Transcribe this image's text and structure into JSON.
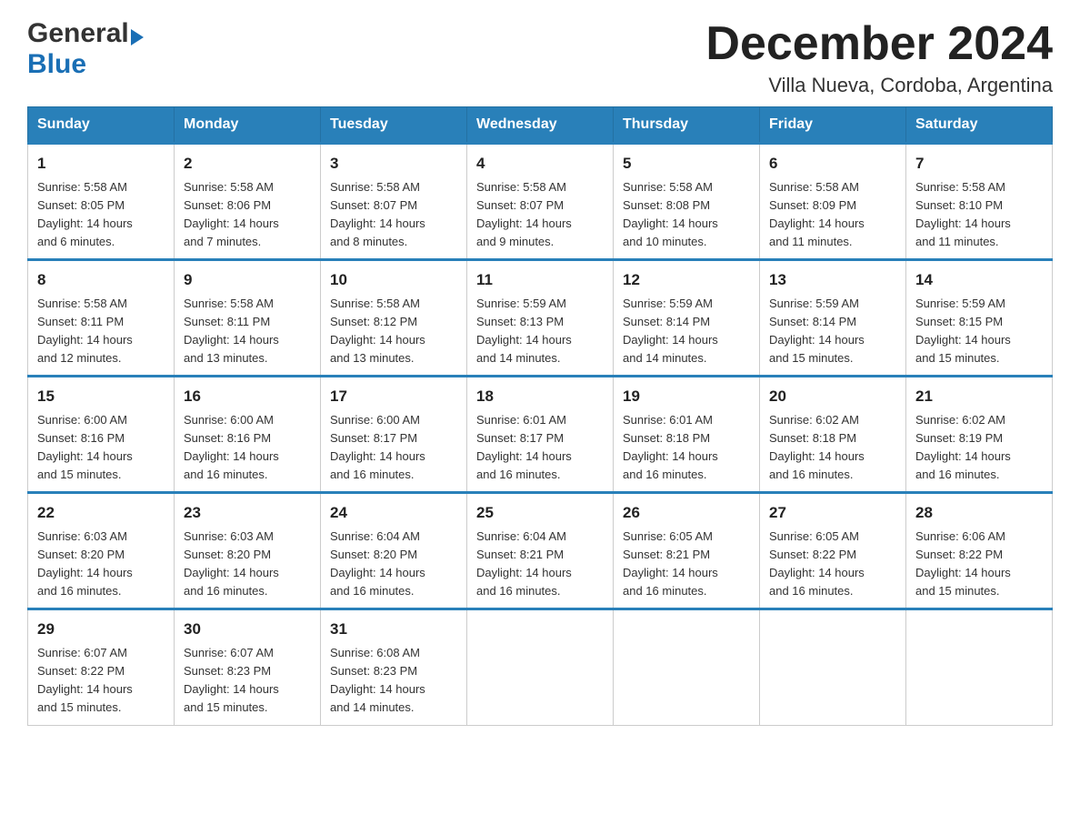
{
  "logo": {
    "general": "General",
    "blue": "Blue",
    "arrow": "▶"
  },
  "title": "December 2024",
  "subtitle": "Villa Nueva, Cordoba, Argentina",
  "days_of_week": [
    "Sunday",
    "Monday",
    "Tuesday",
    "Wednesday",
    "Thursday",
    "Friday",
    "Saturday"
  ],
  "weeks": [
    [
      {
        "day": "1",
        "sunrise": "5:58 AM",
        "sunset": "8:05 PM",
        "daylight": "14 hours and 6 minutes."
      },
      {
        "day": "2",
        "sunrise": "5:58 AM",
        "sunset": "8:06 PM",
        "daylight": "14 hours and 7 minutes."
      },
      {
        "day": "3",
        "sunrise": "5:58 AM",
        "sunset": "8:07 PM",
        "daylight": "14 hours and 8 minutes."
      },
      {
        "day": "4",
        "sunrise": "5:58 AM",
        "sunset": "8:07 PM",
        "daylight": "14 hours and 9 minutes."
      },
      {
        "day": "5",
        "sunrise": "5:58 AM",
        "sunset": "8:08 PM",
        "daylight": "14 hours and 10 minutes."
      },
      {
        "day": "6",
        "sunrise": "5:58 AM",
        "sunset": "8:09 PM",
        "daylight": "14 hours and 11 minutes."
      },
      {
        "day": "7",
        "sunrise": "5:58 AM",
        "sunset": "8:10 PM",
        "daylight": "14 hours and 11 minutes."
      }
    ],
    [
      {
        "day": "8",
        "sunrise": "5:58 AM",
        "sunset": "8:11 PM",
        "daylight": "14 hours and 12 minutes."
      },
      {
        "day": "9",
        "sunrise": "5:58 AM",
        "sunset": "8:11 PM",
        "daylight": "14 hours and 13 minutes."
      },
      {
        "day": "10",
        "sunrise": "5:58 AM",
        "sunset": "8:12 PM",
        "daylight": "14 hours and 13 minutes."
      },
      {
        "day": "11",
        "sunrise": "5:59 AM",
        "sunset": "8:13 PM",
        "daylight": "14 hours and 14 minutes."
      },
      {
        "day": "12",
        "sunrise": "5:59 AM",
        "sunset": "8:14 PM",
        "daylight": "14 hours and 14 minutes."
      },
      {
        "day": "13",
        "sunrise": "5:59 AM",
        "sunset": "8:14 PM",
        "daylight": "14 hours and 15 minutes."
      },
      {
        "day": "14",
        "sunrise": "5:59 AM",
        "sunset": "8:15 PM",
        "daylight": "14 hours and 15 minutes."
      }
    ],
    [
      {
        "day": "15",
        "sunrise": "6:00 AM",
        "sunset": "8:16 PM",
        "daylight": "14 hours and 15 minutes."
      },
      {
        "day": "16",
        "sunrise": "6:00 AM",
        "sunset": "8:16 PM",
        "daylight": "14 hours and 16 minutes."
      },
      {
        "day": "17",
        "sunrise": "6:00 AM",
        "sunset": "8:17 PM",
        "daylight": "14 hours and 16 minutes."
      },
      {
        "day": "18",
        "sunrise": "6:01 AM",
        "sunset": "8:17 PM",
        "daylight": "14 hours and 16 minutes."
      },
      {
        "day": "19",
        "sunrise": "6:01 AM",
        "sunset": "8:18 PM",
        "daylight": "14 hours and 16 minutes."
      },
      {
        "day": "20",
        "sunrise": "6:02 AM",
        "sunset": "8:18 PM",
        "daylight": "14 hours and 16 minutes."
      },
      {
        "day": "21",
        "sunrise": "6:02 AM",
        "sunset": "8:19 PM",
        "daylight": "14 hours and 16 minutes."
      }
    ],
    [
      {
        "day": "22",
        "sunrise": "6:03 AM",
        "sunset": "8:20 PM",
        "daylight": "14 hours and 16 minutes."
      },
      {
        "day": "23",
        "sunrise": "6:03 AM",
        "sunset": "8:20 PM",
        "daylight": "14 hours and 16 minutes."
      },
      {
        "day": "24",
        "sunrise": "6:04 AM",
        "sunset": "8:20 PM",
        "daylight": "14 hours and 16 minutes."
      },
      {
        "day": "25",
        "sunrise": "6:04 AM",
        "sunset": "8:21 PM",
        "daylight": "14 hours and 16 minutes."
      },
      {
        "day": "26",
        "sunrise": "6:05 AM",
        "sunset": "8:21 PM",
        "daylight": "14 hours and 16 minutes."
      },
      {
        "day": "27",
        "sunrise": "6:05 AM",
        "sunset": "8:22 PM",
        "daylight": "14 hours and 16 minutes."
      },
      {
        "day": "28",
        "sunrise": "6:06 AM",
        "sunset": "8:22 PM",
        "daylight": "14 hours and 15 minutes."
      }
    ],
    [
      {
        "day": "29",
        "sunrise": "6:07 AM",
        "sunset": "8:22 PM",
        "daylight": "14 hours and 15 minutes."
      },
      {
        "day": "30",
        "sunrise": "6:07 AM",
        "sunset": "8:23 PM",
        "daylight": "14 hours and 15 minutes."
      },
      {
        "day": "31",
        "sunrise": "6:08 AM",
        "sunset": "8:23 PM",
        "daylight": "14 hours and 14 minutes."
      },
      null,
      null,
      null,
      null
    ]
  ],
  "labels": {
    "sunrise": "Sunrise:",
    "sunset": "Sunset:",
    "daylight": "Daylight:"
  }
}
